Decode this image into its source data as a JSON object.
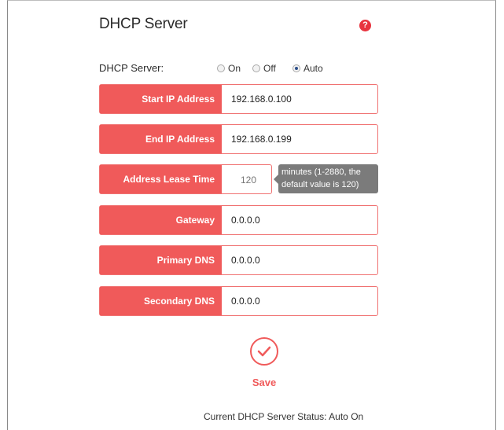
{
  "page": {
    "title": "DHCP Server",
    "help_icon": "question-icon",
    "accent_color": "#f05a5a"
  },
  "mode": {
    "label": "DHCP Server:",
    "options": [
      {
        "label": "On",
        "selected": false
      },
      {
        "label": "Off",
        "selected": false
      },
      {
        "label": "Auto",
        "selected": true
      }
    ]
  },
  "fields": {
    "start_ip": {
      "label": "Start IP Address",
      "value": "192.168.0.100"
    },
    "end_ip": {
      "label": "End IP Address",
      "value": "192.168.0.199"
    },
    "lease_time": {
      "label": "Address Lease Time",
      "placeholder": "120",
      "hint": "minutes (1-2880, the default value is 120)"
    },
    "gateway": {
      "label": "Gateway",
      "value": "0.0.0.0"
    },
    "primary_dns": {
      "label": "Primary DNS",
      "value": "0.0.0.0"
    },
    "secondary_dns": {
      "label": "Secondary DNS",
      "value": "0.0.0.0"
    }
  },
  "save": {
    "label": "Save",
    "icon": "checkmark-icon"
  },
  "status": {
    "text": "Current DHCP Server Status: Auto On"
  }
}
